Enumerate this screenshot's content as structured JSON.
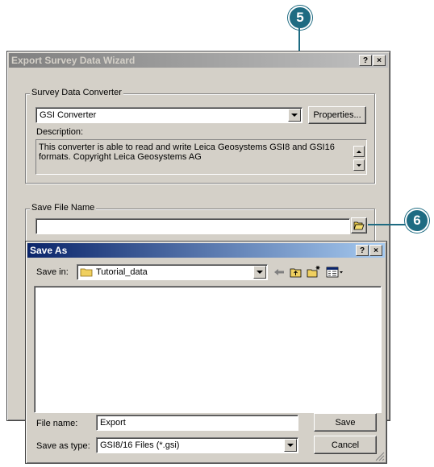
{
  "callouts": {
    "c5": "5",
    "c6": "6"
  },
  "wizard": {
    "title": "Export Survey Data Wizard",
    "help_btn": "?",
    "close_btn": "×",
    "converter_group": "Survey Data Converter",
    "converter_value": "GSI Converter",
    "properties_btn": "Properties...",
    "description_label": "Description:",
    "description_text": "This converter is able to read and write Leica Geosystems GSI8 and GSI16 formats. Copyright Leica Geosystems AG",
    "save_file_group": "Save File Name",
    "save_file_value": ""
  },
  "save_as": {
    "title": "Save As",
    "help_btn": "?",
    "close_btn": "×",
    "save_in_label": "Save in:",
    "save_in_value": "Tutorial_data",
    "file_name_label": "File name:",
    "file_name_value": "Export",
    "save_type_label": "Save as type:",
    "save_type_value": "GSI8/16 Files (*.gsi)",
    "save_btn": "Save",
    "cancel_btn": "Cancel"
  }
}
